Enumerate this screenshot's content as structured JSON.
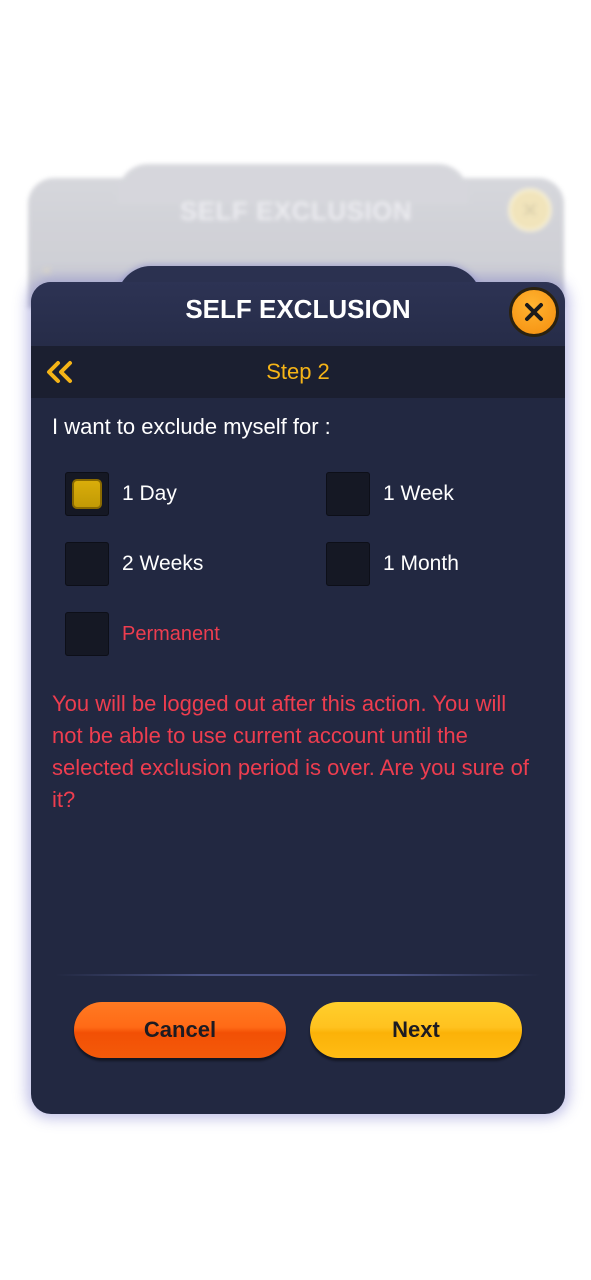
{
  "background_dialog": {
    "title": "SELF EXCLUSION",
    "back_glyph": "«",
    "close_glyph": "✕"
  },
  "dialog": {
    "title": "SELF EXCLUSION",
    "close_icon": "close-x-icon",
    "back_icon": "double-chevron-left-icon",
    "step_label": "Step 2",
    "prompt": "I want to exclude myself for :",
    "options": [
      {
        "label": "1 Day",
        "checked": true
      },
      {
        "label": "1 Week",
        "checked": false
      },
      {
        "label": "2 Weeks",
        "checked": false
      },
      {
        "label": "1 Month",
        "checked": false
      },
      {
        "label": "Permanent",
        "checked": false
      }
    ],
    "warning": "You will be logged out after this action. You will not be able to use current account until the selected exclusion period is over. Are you sure of it?",
    "cancel_label": "Cancel",
    "next_label": "Next"
  },
  "colors": {
    "panel": "#222841",
    "accent_orange": "#f5b417",
    "danger_red": "#ee3d4f",
    "checkbox_fill": "#d9ad0a"
  }
}
